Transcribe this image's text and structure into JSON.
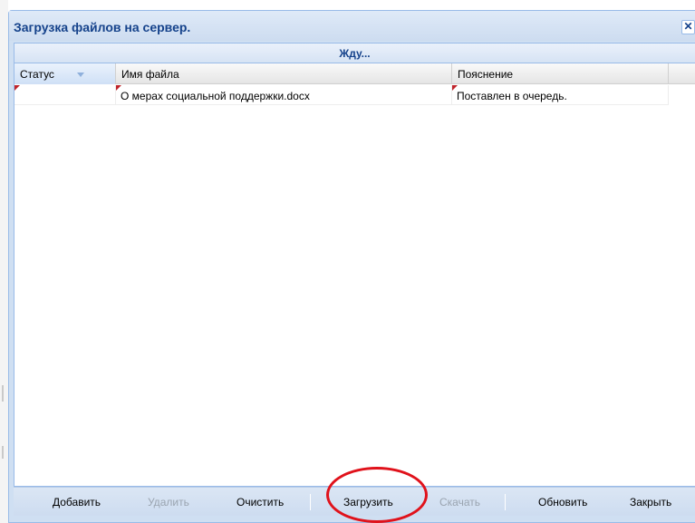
{
  "window": {
    "title": "Загрузка файлов на сервер.",
    "close_glyph": "✕",
    "close_icon": "close-icon"
  },
  "progress": {
    "text": "Жду...",
    "value": 0
  },
  "grid": {
    "columns": [
      {
        "label": "Статус",
        "sorted": "descending"
      },
      {
        "label": "Имя файла"
      },
      {
        "label": "Пояснение"
      }
    ],
    "rows": [
      {
        "status": "",
        "file_name": "О мерах социальной поддержки.docx",
        "note": "Поставлен в очередь."
      }
    ]
  },
  "toolbar": {
    "buttons": [
      {
        "label": "Добавить",
        "enabled": true
      },
      {
        "label": "Удалить",
        "enabled": false
      },
      {
        "label": "Очистить",
        "enabled": true
      },
      {
        "label": "Загрузить",
        "enabled": true,
        "highlighted": true
      },
      {
        "label": "Скачать",
        "enabled": false
      },
      {
        "label": "Обновить",
        "enabled": true
      },
      {
        "label": "Закрыть",
        "enabled": true
      }
    ]
  },
  "colors": {
    "title_text": "#15428b",
    "window_frame": "#cfdff2",
    "highlight": "#e0121b",
    "dirty_marker": "#c0242b"
  }
}
